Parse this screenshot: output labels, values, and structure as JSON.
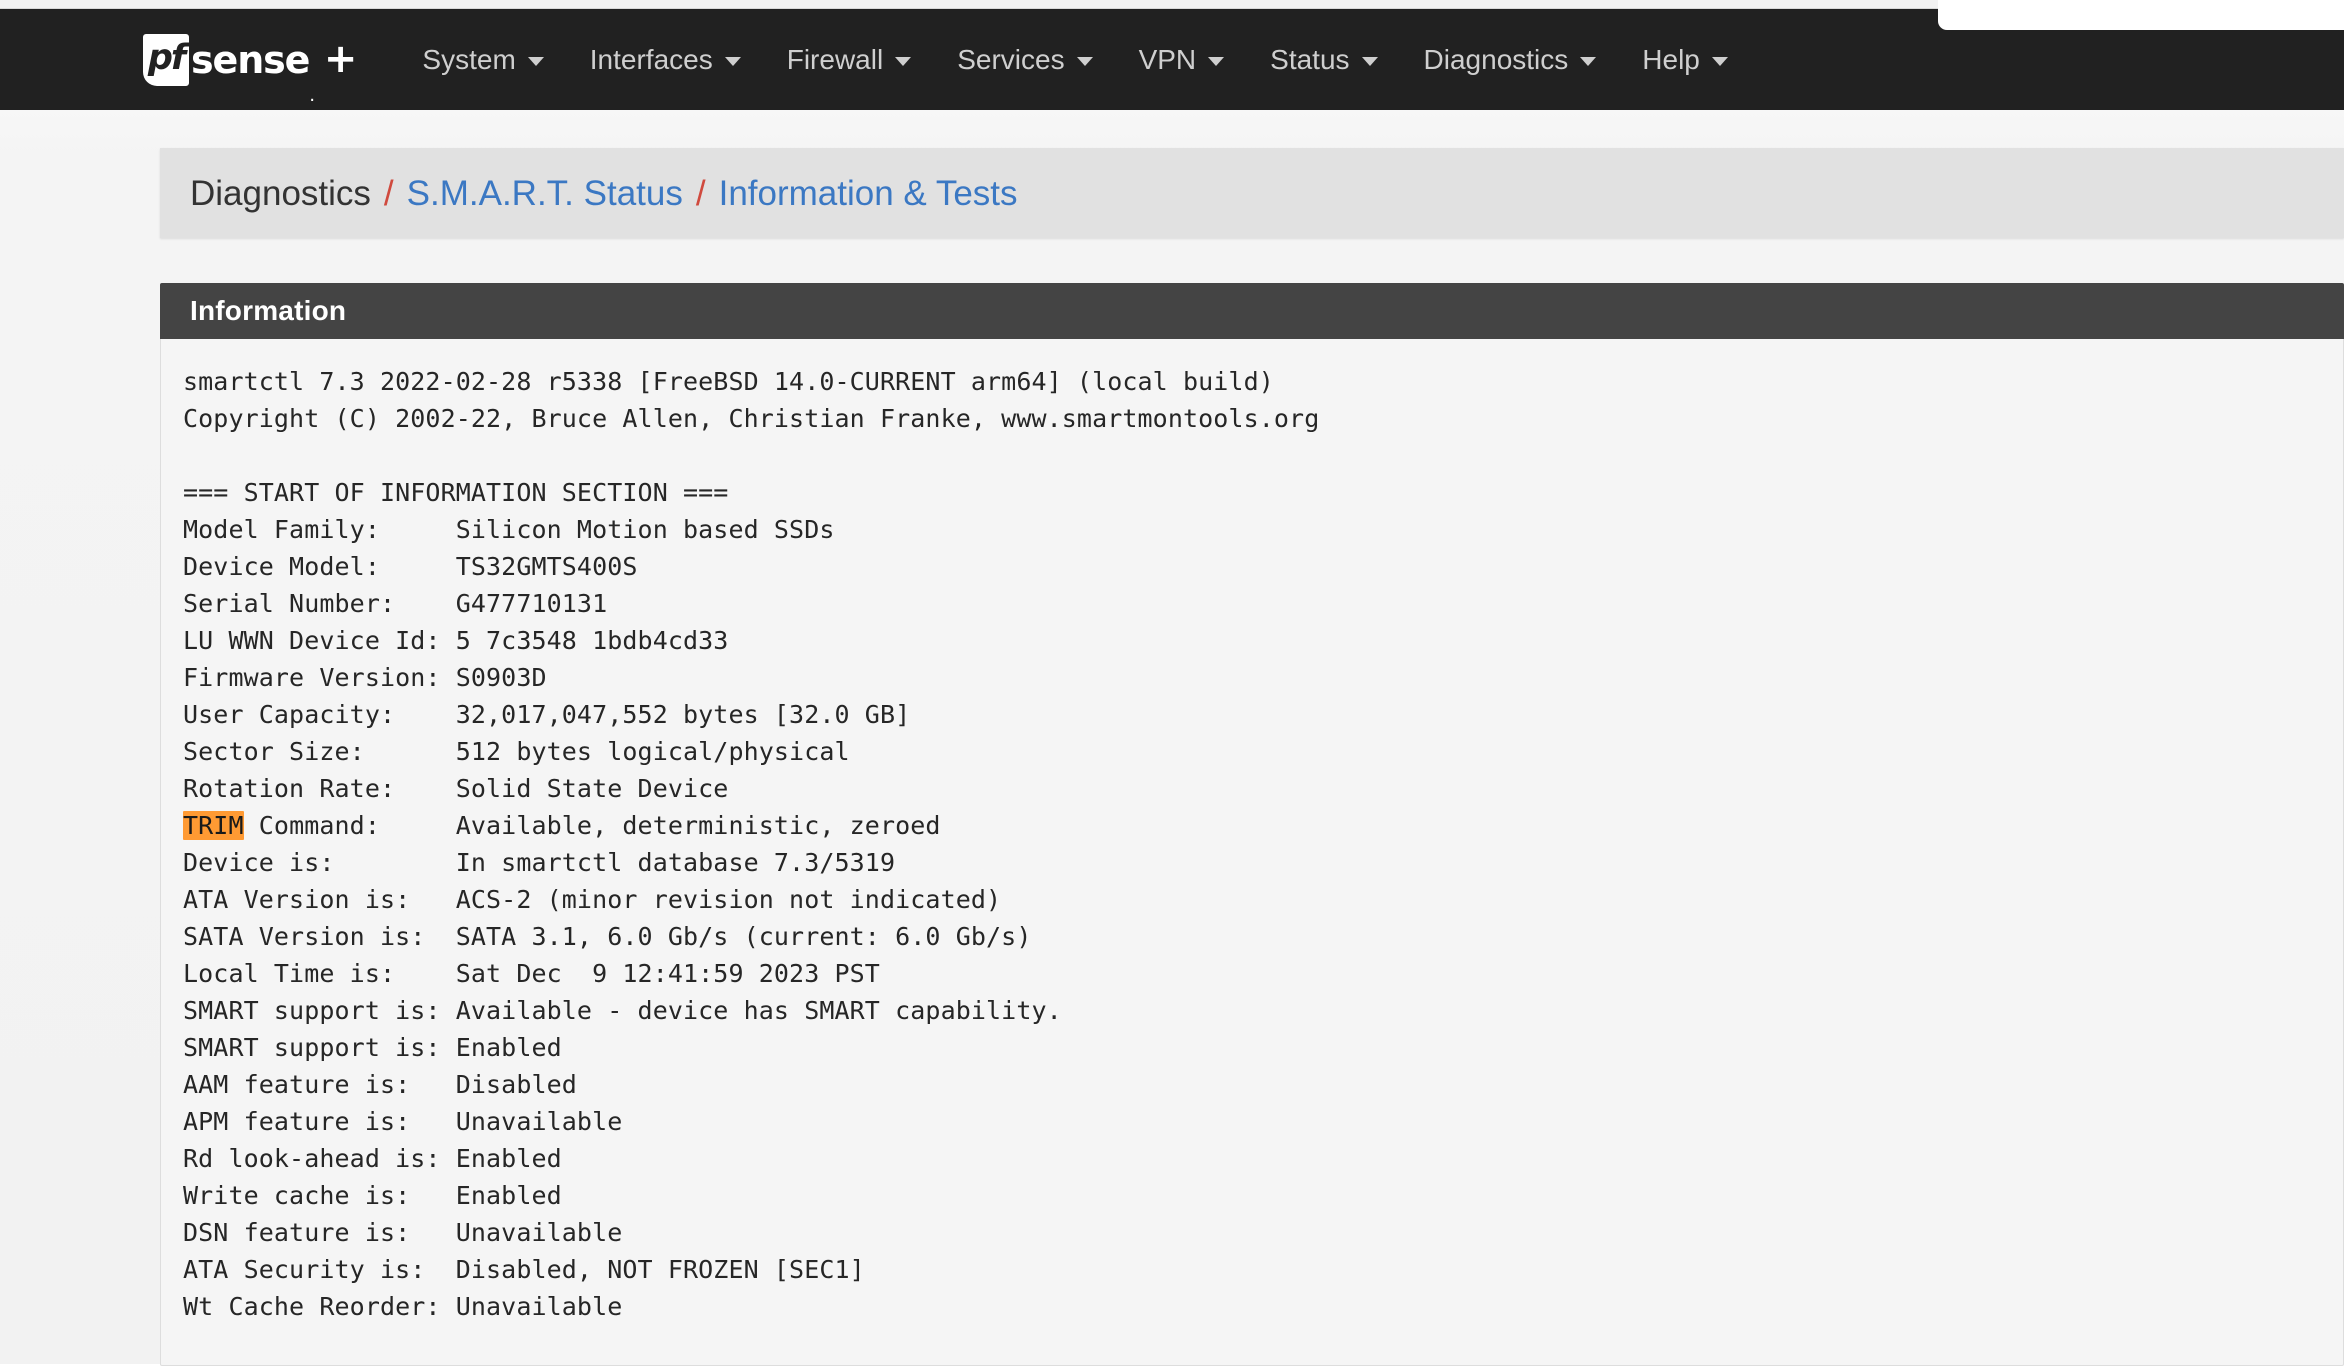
{
  "brand": {
    "mark_text": "pf",
    "word": "sense",
    "dot": ".",
    "plus": "+"
  },
  "navbar": {
    "items": [
      {
        "label": "System",
        "icon": "chevron-down-icon"
      },
      {
        "label": "Interfaces",
        "icon": "chevron-down-icon"
      },
      {
        "label": "Firewall",
        "icon": "chevron-down-icon"
      },
      {
        "label": "Services",
        "icon": "chevron-down-icon"
      },
      {
        "label": "VPN",
        "icon": "chevron-down-icon"
      },
      {
        "label": "Status",
        "icon": "chevron-down-icon"
      },
      {
        "label": "Diagnostics",
        "icon": "chevron-down-icon"
      },
      {
        "label": "Help",
        "icon": "chevron-down-icon"
      }
    ],
    "background_color": "#212121",
    "label_color": "#cfcfcf"
  },
  "breadcrumb": {
    "root": "Diagnostics",
    "separator": "/",
    "separator_color": "#d04a3e",
    "link_color": "#3b78c3",
    "items": [
      "S.M.A.R.T. Status",
      "Information & Tests"
    ]
  },
  "panel": {
    "title": "Information",
    "heading_bg": "#444444",
    "body_bg": "#f5f5f5"
  },
  "smart_output": {
    "highlight_term": "TRIM",
    "highlight_color": "#ff9a33",
    "lines_before_highlight": "smartctl 7.3 2022-02-28 r5338 [FreeBSD 14.0-CURRENT arm64] (local build)\nCopyright (C) 2002-22, Bruce Allen, Christian Franke, www.smartmontools.org\n\n=== START OF INFORMATION SECTION ===\nModel Family:     Silicon Motion based SSDs\nDevice Model:     TS32GMTS400S\nSerial Number:    G477710131\nLU WWN Device Id: 5 7c3548 1bdb4cd33\nFirmware Version: S0903D\nUser Capacity:    32,017,047,552 bytes [32.0 GB]\nSector Size:      512 bytes logical/physical\nRotation Rate:    Solid State Device\n",
    "lines_after_highlight": " Command:     Available, deterministic, zeroed\nDevice is:        In smartctl database 7.3/5319\nATA Version is:   ACS-2 (minor revision not indicated)\nSATA Version is:  SATA 3.1, 6.0 Gb/s (current: 6.0 Gb/s)\nLocal Time is:    Sat Dec  9 12:41:59 2023 PST\nSMART support is: Available - device has SMART capability.\nSMART support is: Enabled\nAAM feature is:   Disabled\nAPM feature is:   Unavailable\nRd look-ahead is: Enabled\nWrite cache is:   Enabled\nDSN feature is:   Unavailable\nATA Security is:  Disabled, NOT FROZEN [SEC1]\nWt Cache Reorder: Unavailable"
  }
}
